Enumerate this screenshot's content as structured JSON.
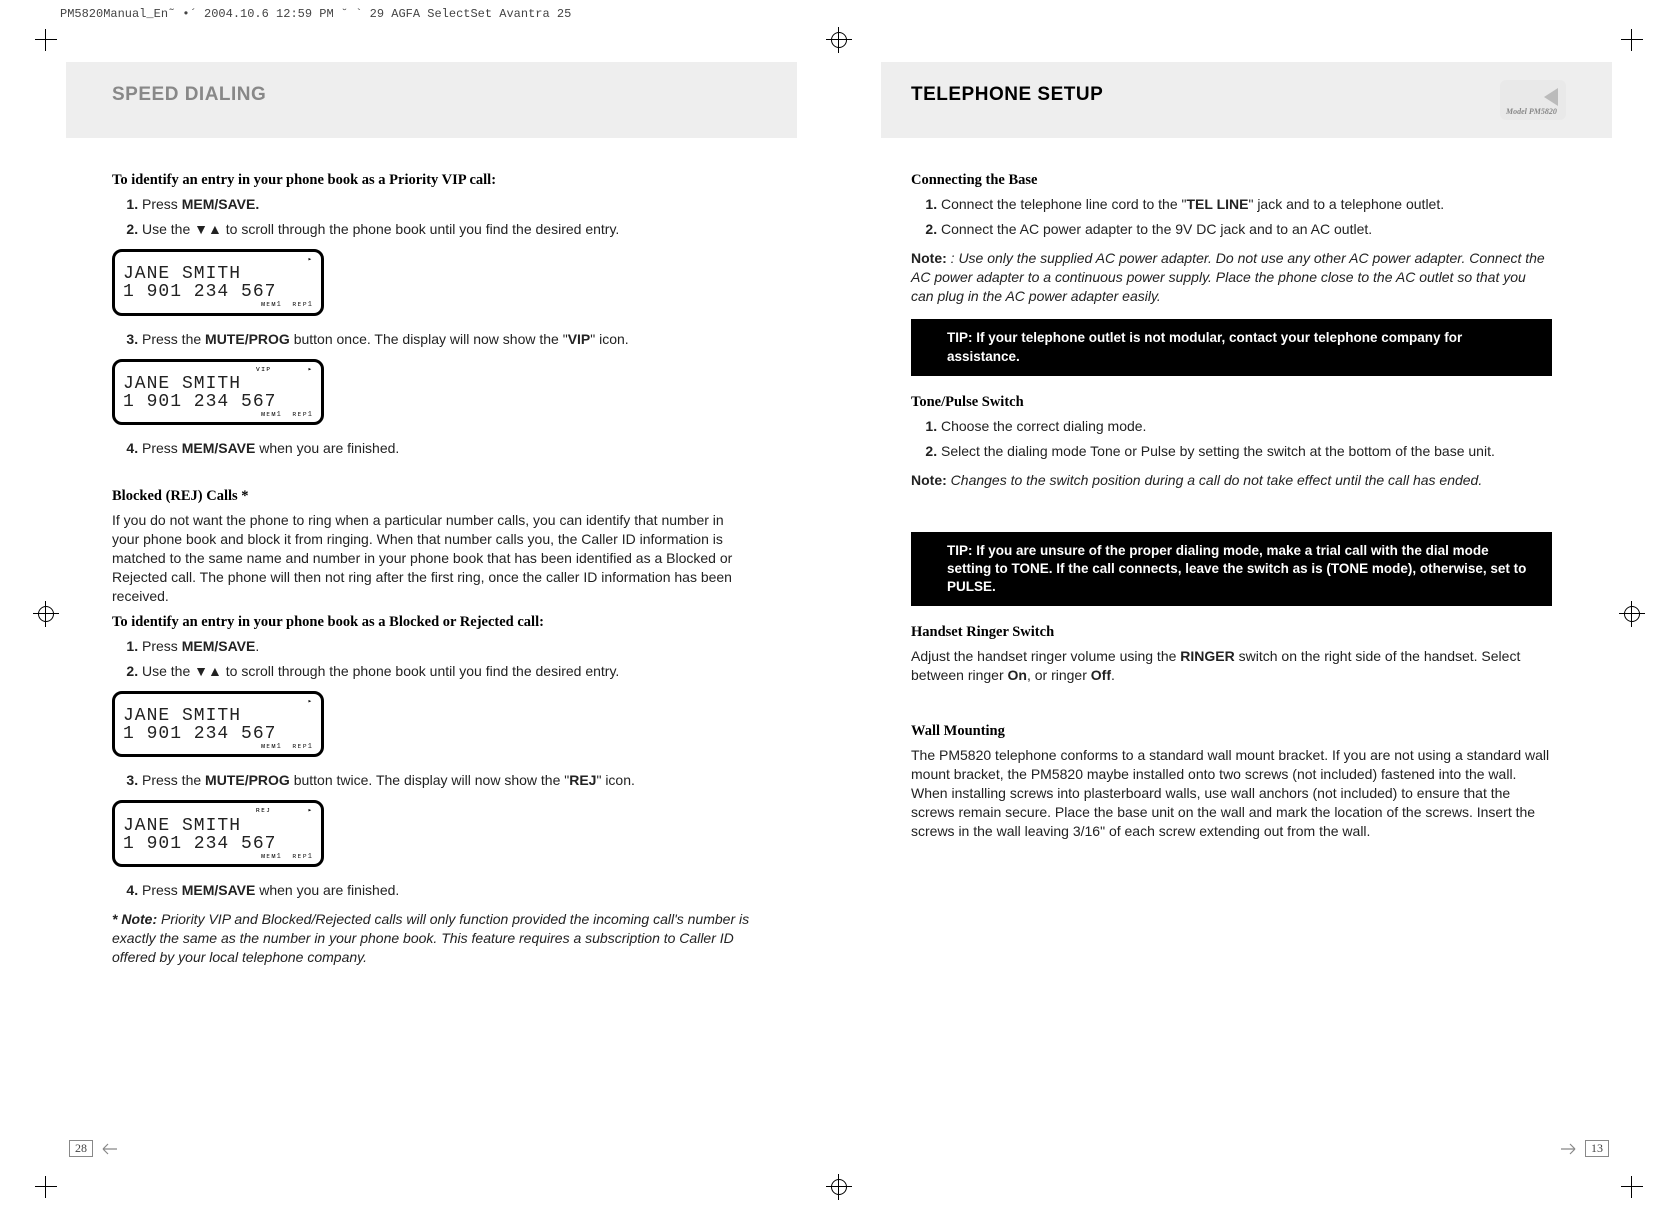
{
  "print_header": "PM5820Manual_En˜  •´  2004.10.6 12:59 PM  ˘  ` 29   AGFA SelectSet Avantra 25",
  "model_label": "Model PM5820",
  "left": {
    "title": "SPEED DIALING",
    "page_number": "28",
    "vip": {
      "heading": "To identify an entry in your phone book as a Priority VIP call:",
      "step1_pre": "Press ",
      "step1_b": "MEM/SAVE.",
      "step2_pre": "Use the ",
      "step2_arrows": "▼▲",
      "step2_post": " to scroll through the phone book until you find the desired entry.",
      "lcd1": {
        "name": "JANE SMITH",
        "num": "1 901 234 567"
      },
      "step3_pre": "Press the ",
      "step3_b": "MUTE/PROG",
      "step3_mid": " button once. The display will now show the \"",
      "step3_b2": "VIP",
      "step3_post": "\" icon.",
      "lcd2": {
        "name": "JANE SMITH",
        "num": "1 901 234 567"
      },
      "step4_pre": "Press ",
      "step4_b": "MEM/SAVE",
      "step4_post": " when you are finished."
    },
    "rej": {
      "heading": "Blocked (REJ) Calls *",
      "intro": "If you do not want the phone to ring when a particular number calls, you can identify that number in your phone book and block it from ringing. When that number calls you, the Caller ID information is matched to the same name and number in your phone book that has been identified as a Blocked or Rejected call. The phone will then not ring after the first ring, once the caller ID information has been received.",
      "subheading": "To identify an entry in your phone book as a Blocked or Rejected call:",
      "step1_pre": "Press ",
      "step1_b": "MEM/SAVE",
      "step1_post": ".",
      "step2_pre": "Use the ",
      "step2_arrows": "▼▲",
      "step2_post": " to scroll through the phone book until you find the desired entry.",
      "lcd1": {
        "name": "JANE SMITH",
        "num": "1 901 234 567"
      },
      "step3_pre": "Press the ",
      "step3_b": "MUTE/PROG",
      "step3_mid": " button twice. The display will now show the \"",
      "step3_b2": "REJ",
      "step3_post": "\" icon.",
      "lcd2": {
        "name": "JANE SMITH",
        "num": "1 901 234 567"
      },
      "step4_pre": "Press ",
      "step4_b": "MEM/SAVE",
      "step4_post": " when you are finished.",
      "footnote_label": "* Note:",
      "footnote_text": " Priority VIP and Blocked/Rejected calls will only function provided the incoming call's number is exactly the same as the number in your phone book. This feature requires a subscription to Caller ID offered by your local telephone company."
    }
  },
  "right": {
    "title": "TELEPHONE SETUP",
    "page_number": "13",
    "base": {
      "heading": "Connecting the Base",
      "s1_pre": "Connect the telephone line cord to the \"",
      "s1_b": "TEL LINE",
      "s1_post": "\" jack and to a telephone outlet.",
      "s2": "Connect the AC power adapter to the 9V DC jack and to an AC outlet.",
      "note_label": "Note:",
      "note_text": " : Use only the supplied AC power adapter. Do not use any other AC power adapter. Connect the AC power adapter to a continuous power supply. Place the phone close to the AC outlet so that you can plug in the AC power adapter easily.",
      "tip_label": "TIP:",
      "tip_text": " If your telephone outlet is not modular, contact your telephone company for assistance."
    },
    "tone": {
      "heading": "Tone/Pulse Switch",
      "s1": "Choose the correct dialing mode.",
      "s2": "Select the dialing mode Tone or Pulse by setting the switch at the bottom of the base unit.",
      "note_label": "Note:",
      "note_text": " Changes to the switch position during a call do not take effect until the call has ended.",
      "tip_label": "TIP:",
      "tip_text": " If you are unsure of the proper dialing mode, make a trial call with the dial mode setting to TONE. If the call connects, leave the switch as is (TONE mode), otherwise, set to PULSE."
    },
    "ringer": {
      "heading": "Handset Ringer Switch",
      "t1": "Adjust the handset ringer volume using the ",
      "b1": "RINGER",
      "t2": " switch on the right side of the handset. Select between ringer ",
      "b2": "On",
      "t3": ", or ringer ",
      "b3": "Off",
      "t4": "."
    },
    "wall": {
      "heading": "Wall Mounting",
      "text": "The PM5820 telephone conforms to a standard wall mount bracket. If you are not using a standard wall mount bracket, the PM5820 maybe installed onto two screws (not included) fastened into the wall. When installing screws into plasterboard  walls, use wall anchors (not included) to ensure that the screws remain secure.  Place the base unit on the wall and mark the location of the screws. Insert the  screws in the wall leaving 3/16\" of each screw extending out from the wall."
    }
  }
}
